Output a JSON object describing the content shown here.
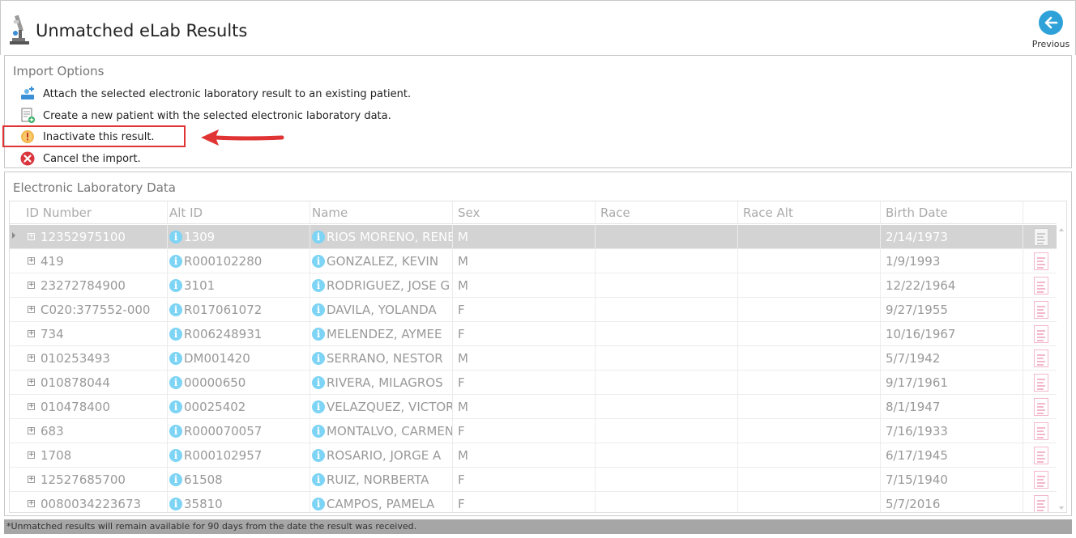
{
  "header": {
    "title": "Unmatched eLab Results",
    "previous_label": "Previous"
  },
  "import_options": {
    "heading": "Import Options",
    "options": [
      {
        "label": "Attach the selected electronic laboratory result to an existing patient.",
        "icon": "attach-patient-icon"
      },
      {
        "label": "Create a new patient with the selected electronic laboratory data.",
        "icon": "new-patient-icon"
      },
      {
        "label": "Inactivate this result.",
        "icon": "warning-icon"
      },
      {
        "label": "Cancel the import.",
        "icon": "cancel-icon"
      }
    ]
  },
  "lab_data": {
    "heading": "Electronic Laboratory Data",
    "columns": [
      "ID Number",
      "Alt ID",
      "Name",
      "Sex",
      "Race",
      "Race Alt",
      "Birth Date"
    ],
    "rows": [
      {
        "id": "12352975100",
        "alt_id": "1309",
        "name": "RIOS MORENO, RENE",
        "sex": "M",
        "race": "",
        "race_alt": "",
        "birth": "2/14/1973"
      },
      {
        "id": "419",
        "alt_id": "R000102280",
        "name": "GONZALEZ, KEVIN",
        "sex": "M",
        "race": "",
        "race_alt": "",
        "birth": "1/9/1993"
      },
      {
        "id": "23272784900",
        "alt_id": "3101",
        "name": "RODRIGUEZ, JOSE G",
        "sex": "M",
        "race": "",
        "race_alt": "",
        "birth": "12/22/1964"
      },
      {
        "id": "C020:377552-000",
        "alt_id": "R017061072",
        "name": "DAVILA, YOLANDA",
        "sex": "F",
        "race": "",
        "race_alt": "",
        "birth": "9/27/1955"
      },
      {
        "id": "734",
        "alt_id": "R006248931",
        "name": "MELENDEZ, AYMEE",
        "sex": "F",
        "race": "",
        "race_alt": "",
        "birth": "10/16/1967"
      },
      {
        "id": "010253493",
        "alt_id": "DM001420",
        "name": "SERRANO, NESTOR",
        "sex": "M",
        "race": "",
        "race_alt": "",
        "birth": "5/7/1942"
      },
      {
        "id": "010878044",
        "alt_id": "00000650",
        "name": "RIVERA, MILAGROS",
        "sex": "F",
        "race": "",
        "race_alt": "",
        "birth": "9/17/1961"
      },
      {
        "id": "010478400",
        "alt_id": "00025402",
        "name": "VELAZQUEZ, VICTOR I",
        "sex": "M",
        "race": "",
        "race_alt": "",
        "birth": "8/1/1947"
      },
      {
        "id": "683",
        "alt_id": "R000070057",
        "name": "MONTALVO, CARMEN",
        "sex": "F",
        "race": "",
        "race_alt": "",
        "birth": "7/16/1933"
      },
      {
        "id": "1708",
        "alt_id": "R000102957",
        "name": "ROSARIO, JORGE A",
        "sex": "M",
        "race": "",
        "race_alt": "",
        "birth": "6/17/1945"
      },
      {
        "id": "12527685700",
        "alt_id": "61508",
        "name": "RUIZ, NORBERTA",
        "sex": "F",
        "race": "",
        "race_alt": "",
        "birth": "7/15/1940"
      },
      {
        "id": "0080034223673",
        "alt_id": "35810",
        "name": "CAMPOS, PAMELA",
        "sex": "F",
        "race": "",
        "race_alt": "",
        "birth": "5/7/2016"
      }
    ]
  },
  "footer": {
    "note": "*Unmatched results will remain available for 90 days from the date the result was received."
  },
  "colors": {
    "accent": "#2ea2d8",
    "highlight_box": "#e03434",
    "info_badge": "#7dd4f5",
    "selected_row": "#d3d3d3",
    "footer_bg": "#a6a6a6"
  }
}
